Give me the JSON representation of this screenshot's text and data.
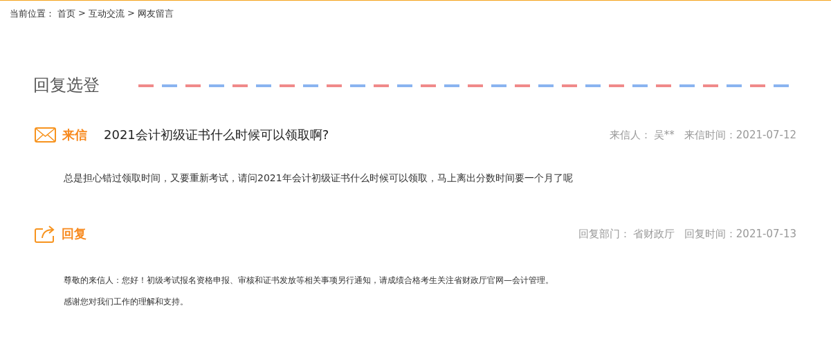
{
  "breadcrumb": {
    "label": "当前位置：",
    "links": [
      "首页",
      "互动交流",
      "网友留言"
    ],
    "separator": ">"
  },
  "section_title": "回复选登",
  "letter": {
    "label": "来信",
    "title": "2021会计初级证书什么时候可以领取啊?",
    "sender_label": "来信人：",
    "sender": "吴**",
    "date_label": "来信时间：",
    "date": "2021-07-12",
    "body": "总是担心错过领取时间，又要重新考试，请问2021年会计初级证书什么时候可以领取，马上离出分数时间要一个月了呢"
  },
  "reply": {
    "label": "回复",
    "dept_label": "回复部门：",
    "dept": "省财政厅",
    "date_label": "回复时间：",
    "date": "2021-07-13",
    "paragraphs": [
      "尊敬的来信人：您好！初级考试报名资格申报、审核和证书发放等相关事项另行通知，请成绩合格考生关注省财政厅官网—会计管理。",
      "感谢您对我们工作的理解和支持。"
    ]
  }
}
